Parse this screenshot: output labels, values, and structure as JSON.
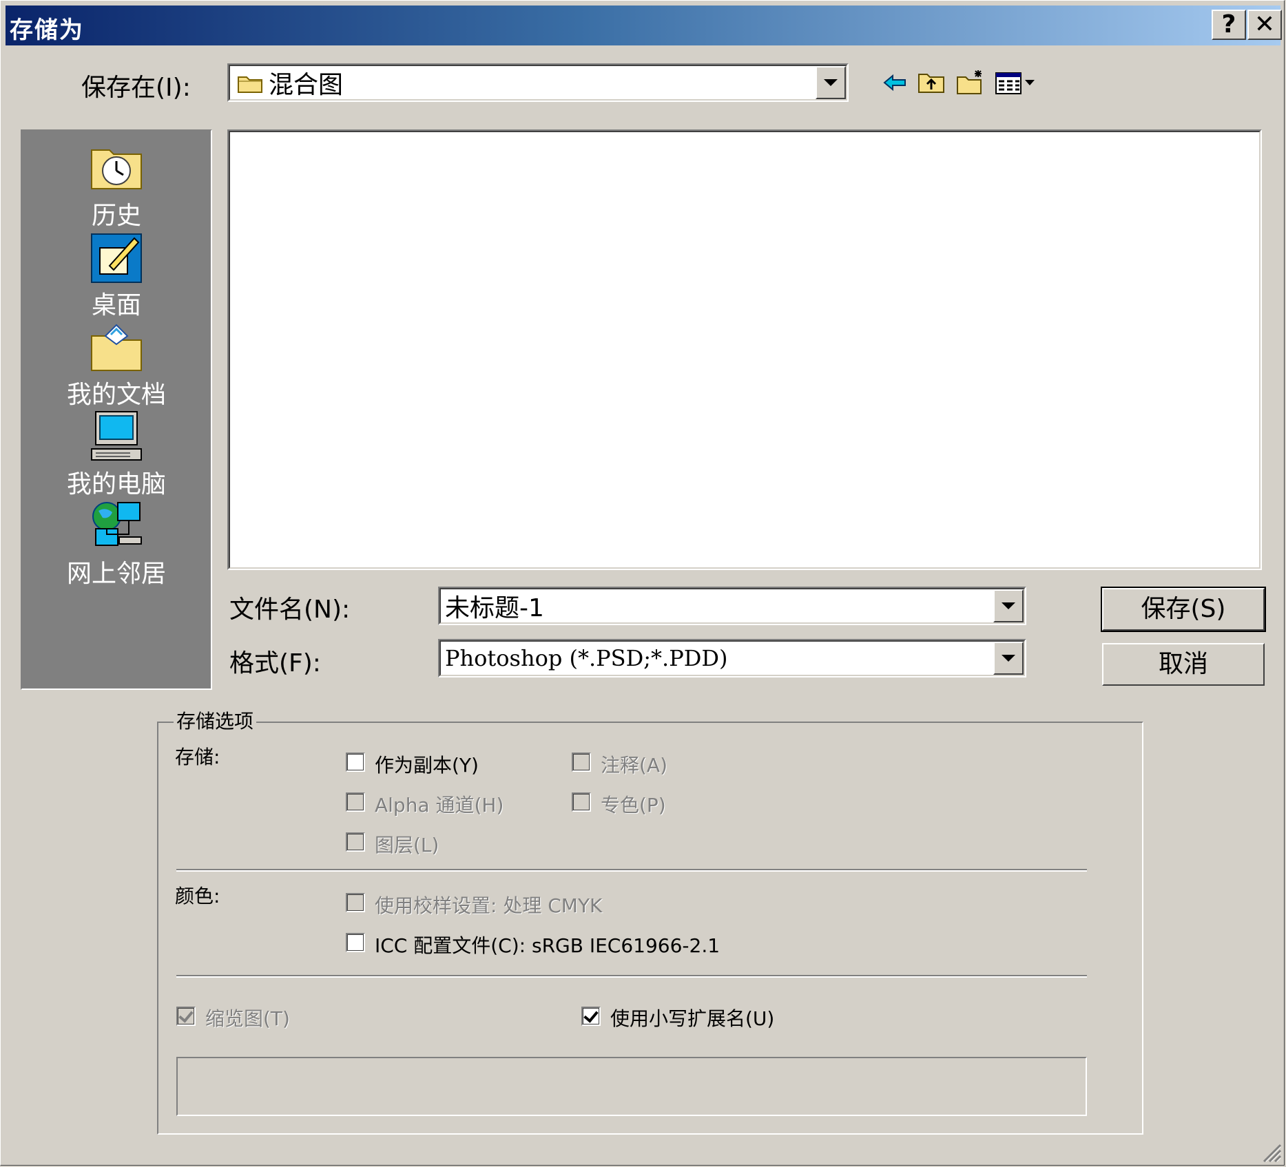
{
  "window": {
    "title": "存储为",
    "help_label": "?",
    "close_label": "✕"
  },
  "save_in": {
    "label": "保存在(I):",
    "value": "混合图"
  },
  "places": [
    {
      "label": "历史",
      "icon": "history-folder-icon"
    },
    {
      "label": "桌面",
      "icon": "desktop-icon"
    },
    {
      "label": "我的文档",
      "icon": "my-documents-icon"
    },
    {
      "label": "我的电脑",
      "icon": "my-computer-icon"
    },
    {
      "label": "网上邻居",
      "icon": "network-neighborhood-icon"
    }
  ],
  "filename": {
    "label": "文件名(N):",
    "value": "未标题-1"
  },
  "format": {
    "label": "格式(F):",
    "value": "Photoshop (*.PSD;*.PDD)"
  },
  "buttons": {
    "save": "保存(S)",
    "cancel": "取消"
  },
  "options": {
    "group_title": "存储选项",
    "store_label": "存储:",
    "as_copy": "作为副本(Y)",
    "annotations": "注释(A)",
    "alpha": "Alpha 通道(H)",
    "spot": "专色(P)",
    "layers": "图层(L)",
    "color_label": "颜色:",
    "proof": "使用校样设置: 处理 CMYK",
    "icc": "ICC 配置文件(C): sRGB IEC61966-2.1",
    "thumbnail": "缩览图(T)",
    "lowercase": "使用小写扩展名(U)"
  },
  "colors": {
    "title_start": "#0a246a",
    "title_end": "#a6caf0",
    "face": "#d4d0c8",
    "places_bg": "#808080"
  }
}
